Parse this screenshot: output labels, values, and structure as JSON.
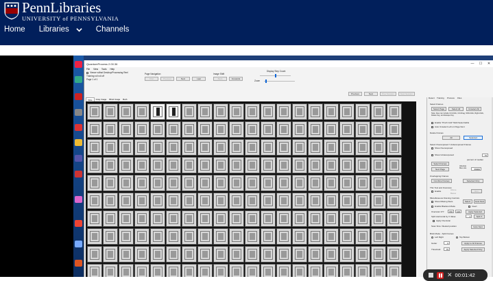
{
  "site": {
    "logo_main": "PennLibraries",
    "logo_sub": "UNIVERSITY of PENNSYLVANIA",
    "nav": [
      {
        "label": "Home"
      },
      {
        "label": "Libraries"
      },
      {
        "label": "Channels"
      }
    ]
  },
  "app": {
    "title": "QuantumProcess 2.00.36",
    "window_controls": [
      "—",
      "☐",
      "✕"
    ],
    "menu": [
      "File",
      "View",
      "Tools",
      "Help"
    ],
    "toolbar": {
      "option1": "Viewer w/that Desktop/Processing Reel",
      "option2": "Training roll roll off",
      "page_of": "Page 1 of 1",
      "page_nav_label": "Page Navigation",
      "first": "First",
      "prev_page": "Previous",
      "next": "Next",
      "last": "Last",
      "image_shift_label": "Image Shift",
      "back": "Back",
      "forwards": "Forwards",
      "display_step_label": "Display Step Count",
      "zoom_label": "Zoom",
      "prev": "Previous",
      "next2": "Next",
      "prev_session": "Prev Session",
      "next_session": "Next Session"
    },
    "tabs": [
      "Slide",
      "Gray Image",
      "Blind Image",
      "Both"
    ],
    "side_tabs": [
      "Detect",
      "Training",
      "Process",
      "Files"
    ],
    "panel": {
      "select_frames": "Select Frames",
      "select_page": "Select Page",
      "select_all": "Select All",
      "unselect_all": "Unselect All",
      "note": "Note: Also can include Ctrl-Click, Ctrl-Drag, Shift-Click, Right-Click, Delete Key, and Escape Key.",
      "enable_pinch": "Enable \"Pinch Grid\" Multi Select Edits",
      "auto_unselect": "Auto Unselect Left on Page Next",
      "delete_frames": "Delete Frames",
      "all": "All",
      "selected": "Selected",
      "select_overexposed": "Select Overexposed / Underexposed Frames",
      "show_overexposed": "Show Overexposed",
      "show_underexposed": "Show Underexposed",
      "under_value": "75",
      "percent_median": "percent of median",
      "select_frames_btn": "Select Frames",
      "next_page": "Next Page",
      "absolute_label": "Absolute Max size",
      "absolute_value": "65000",
      "overlapping": "Overlapping Frames",
      "combine": "Combine Frames",
      "selected_only": "Selected Only",
      "thin_tool": "Thin Tool and Overscan",
      "enable": "Enable",
      "above": "Above",
      "below": "Below",
      "run": "Run",
      "misc": "Miscellaneous Framing Controls",
      "show_missing": "Show Missing Stars",
      "select": "Select",
      "goto_next": "Goto Next",
      "enable_blackout": "Enable Blackout Mode",
      "invert": "Invert",
      "overscan_label": "Overscan X/Y:",
      "overscan_x": "150",
      "overscan_y": "100",
      "apply_selected": "Apply Selected",
      "split_label": "Split Horizontal by X Value:",
      "split_value": "1",
      "split_btn": "Split X",
      "apply_overscan": "Apply Overscan",
      "scan_size": "Scan Size / Restart position",
      "goto_next2": "Goto Next",
      "brick_mode": "Brick Mode - Split Frames",
      "left_right": "Left Right",
      "top_bottom": "Top Bottom",
      "gutter_label": "Gutter",
      "gutter_value": "0",
      "apply_all": "Apply to All Frames",
      "threshold_label": "Threshold",
      "threshold_value": "75",
      "apply_selected_only": "Apply Selected Only"
    }
  },
  "recorder": {
    "elapsed": "00:01:42"
  }
}
